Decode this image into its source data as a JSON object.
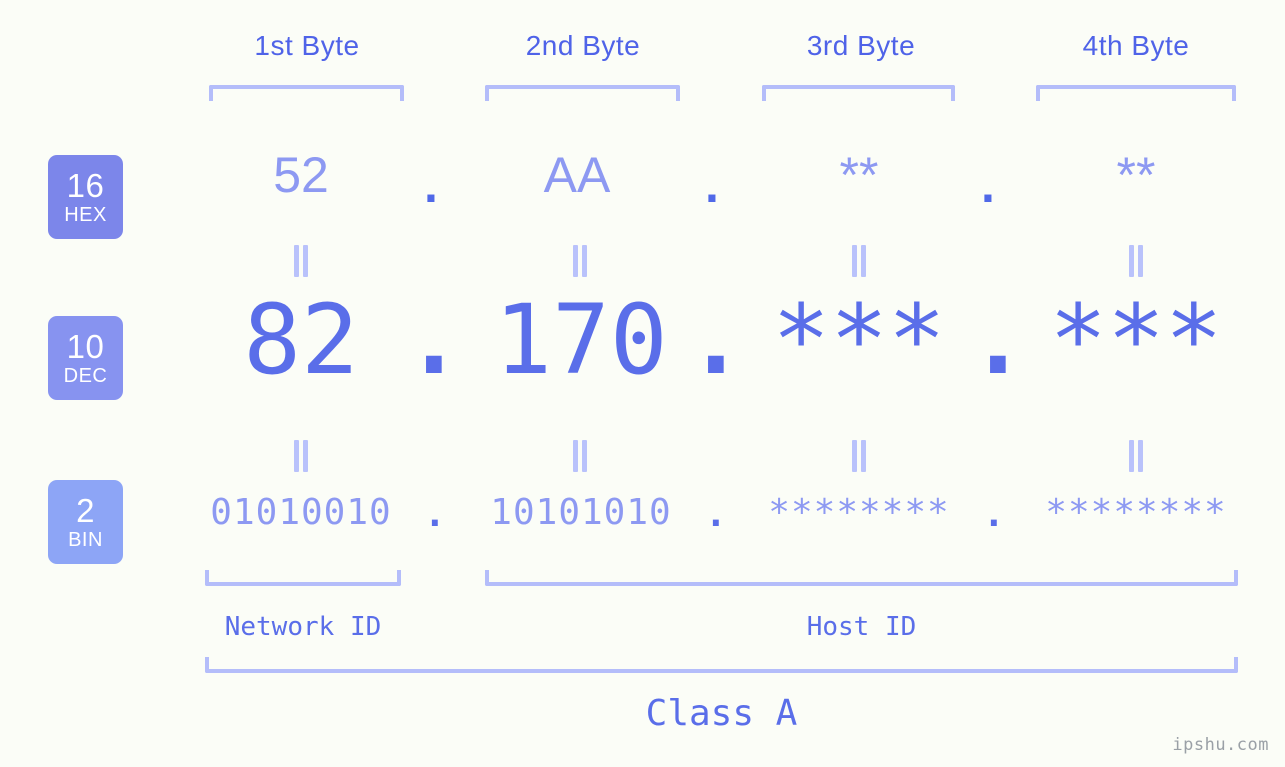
{
  "theme": {
    "background": "#fbfdf7",
    "accent_strong": "#5a6ee9",
    "accent_medium": "#8d99f2",
    "accent_light": "#b4bdfa",
    "badge_hex": "#7c86ea",
    "badge_dec": "#8793f0",
    "badge_bin": "#8da5f6",
    "watermark_color": "#9aa0a6"
  },
  "byte_headers": [
    {
      "label": "1st Byte"
    },
    {
      "label": "2nd Byte"
    },
    {
      "label": "3rd Byte"
    },
    {
      "label": "4th Byte"
    }
  ],
  "bases": [
    {
      "number": "16",
      "name": "HEX"
    },
    {
      "number": "10",
      "name": "DEC"
    },
    {
      "number": "2",
      "name": "BIN"
    }
  ],
  "rows": {
    "hex": {
      "base_number": "16",
      "base_name": "HEX",
      "values": [
        "52",
        "AA",
        "**",
        "**"
      ],
      "separators": [
        ".",
        ".",
        "."
      ]
    },
    "dec": {
      "base_number": "10",
      "base_name": "DEC",
      "values": [
        "82",
        "170",
        "***",
        "***"
      ],
      "separators": [
        ".",
        ".",
        "."
      ]
    },
    "bin": {
      "base_number": "2",
      "base_name": "BIN",
      "values": [
        "01010010",
        "10101010",
        "********",
        "********"
      ],
      "separators": [
        ".",
        ".",
        "."
      ]
    }
  },
  "equals_marks": {
    "symbol": "=",
    "count_per_row_gap": 4,
    "rows": [
      "hex-to-dec",
      "dec-to-bin"
    ]
  },
  "sections": [
    {
      "label": "Network ID"
    },
    {
      "label": "Host ID"
    }
  ],
  "class_label": "Class A",
  "watermark": "ipshu.com",
  "chart_data": {
    "type": "table",
    "title": "IP address byte breakdown",
    "columns": [
      "1st Byte",
      "2nd Byte",
      "3rd Byte",
      "4th Byte"
    ],
    "rows": [
      {
        "base": "16 HEX",
        "cells": [
          "52",
          "AA",
          "**",
          "**"
        ]
      },
      {
        "base": "10 DEC",
        "cells": [
          "82",
          "170",
          "***",
          "***"
        ]
      },
      {
        "base": "2 BIN",
        "cells": [
          "01010010",
          "10101010",
          "********",
          "********"
        ]
      }
    ],
    "groupings": [
      {
        "label": "Network ID",
        "bytes": [
          1
        ]
      },
      {
        "label": "Host ID",
        "bytes": [
          2,
          3,
          4
        ]
      },
      {
        "label": "Class A",
        "bytes": [
          1,
          2,
          3,
          4
        ]
      }
    ]
  }
}
